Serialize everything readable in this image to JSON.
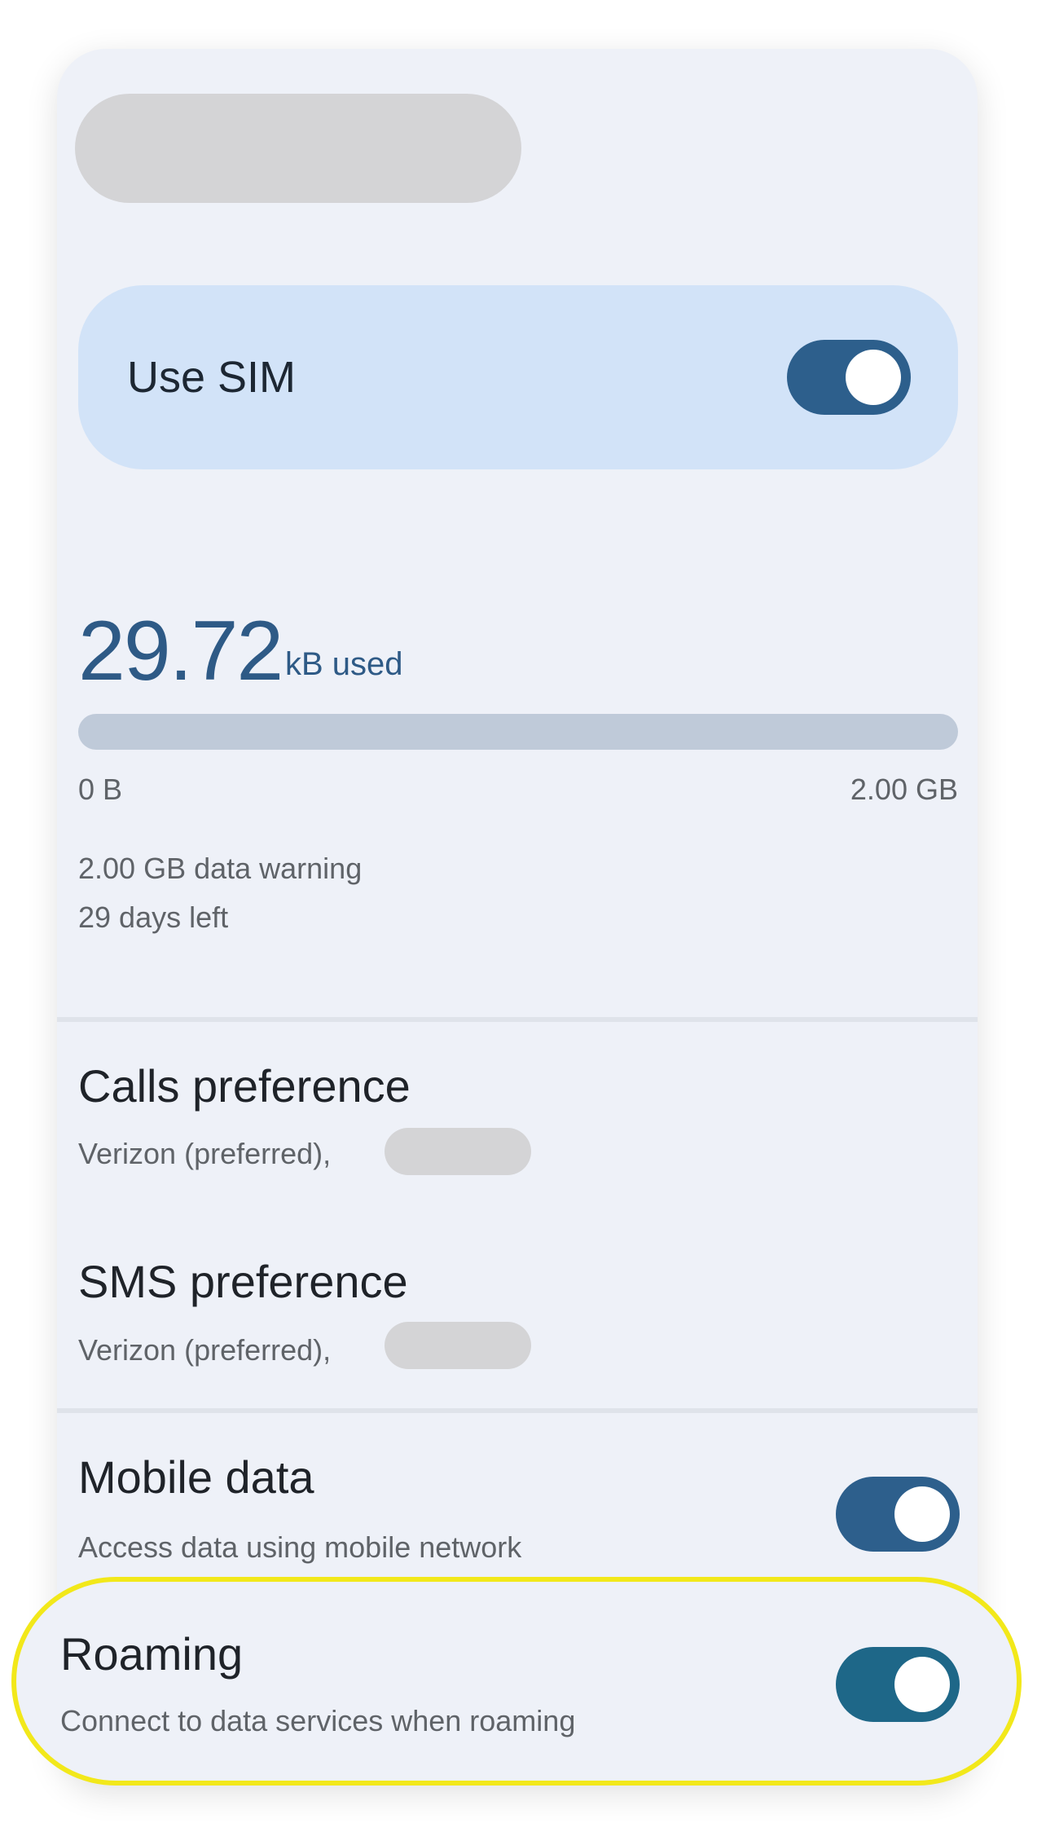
{
  "use_sim": {
    "label": "Use SIM",
    "enabled": true
  },
  "usage": {
    "amount": "29.72",
    "unit": "kB used",
    "progress_fraction": 0.0,
    "bar_min": "0 B",
    "bar_max": "2.00 GB",
    "warning": "2.00 GB data warning",
    "days_left": "29 days left"
  },
  "calls_preference": {
    "title": "Calls preference",
    "subtitle": "Verizon (preferred),"
  },
  "sms_preference": {
    "title": "SMS preference",
    "subtitle": "Verizon (preferred),"
  },
  "mobile_data": {
    "title": "Mobile data",
    "subtitle": "Access data using mobile network",
    "enabled": true
  },
  "roaming": {
    "title": "Roaming",
    "subtitle": "Connect to data services when roaming",
    "enabled": true
  },
  "colors": {
    "card_background": "#eef1f8",
    "use_sim_background": "#d2e3f8",
    "toggle_on": "#2d5f8c",
    "accent_text": "#2e5a86",
    "highlight": "#f2e81a",
    "redaction": "#d4d4d6"
  }
}
